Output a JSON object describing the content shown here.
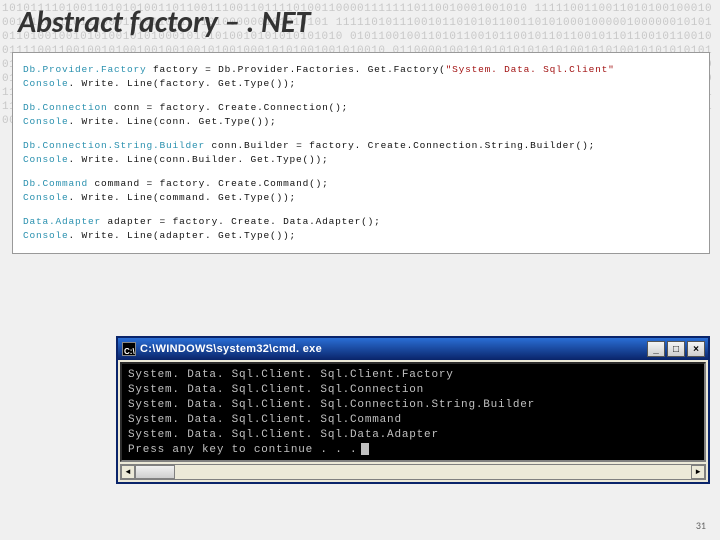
{
  "title": "Abstract factory – . NET",
  "page_number": "31",
  "bg_binary": "10101111010011010101001101100111001101111010011000011111110110010001001010 11111001100110101001000100011110011011000011101101110101000000101010101 11111010111001011010101100110101000100000100000010101 011010010010101001010100010101010010101010101010 010110010011010110010110010110110010110110010110010 011110011001001010010010010010100100010101001001010010 011000010010101010101010100101010010101010101010100101001 11100001001010010010010010010010001001010010010010100 010111010110011001011000111010110010110010111 011111000110011111110100100101001010010010010010010010010010 10010100001001100100100100111001111110001001001100000001000010110011111110 000010110111111011111011110010111011100001110100101111100010100010110011 1011101101011100100000011000010001101010011001101001001111101010010001001101010011101",
  "code": {
    "group1": {
      "line1": {
        "type": "Db.Provider.Factory",
        "var": "factory",
        "assign": "Db.Provider.Factories. Get.Factory(",
        "str": "\"System. Data. Sql.Client\"",
        "end": ""
      },
      "line2": "Console. Write. Line(factory. Get.Type());"
    },
    "group2": {
      "line1": {
        "type": "Db.Connection",
        "var": "conn",
        "assign": "factory. Create.Connection();"
      },
      "line2": "Console. Write. Line(conn. Get.Type());"
    },
    "group3": {
      "line1": {
        "type": "Db.Connection.String.Builder",
        "var": "conn.Builder",
        "assign": "factory. Create.Connection.String.Builder();"
      },
      "line2": "Console. Write. Line(conn.Builder. Get.Type());"
    },
    "group4": {
      "line1": {
        "type": "Db.Command",
        "var": "command",
        "assign": "factory. Create.Command();"
      },
      "line2": "Console. Write. Line(command. Get.Type());"
    },
    "group5": {
      "line1": {
        "type": "Data.Adapter",
        "var": "adapter",
        "assign": "factory. Create. Data.Adapter();"
      },
      "line2": "Console. Write. Line(adapter. Get.Type());"
    }
  },
  "cmd": {
    "title": "C:\\WINDOWS\\system32\\cmd. exe",
    "lines": [
      "System. Data. Sql.Client. Sql.Client.Factory",
      "System. Data. Sql.Client. Sql.Connection",
      "System. Data. Sql.Client. Sql.Connection.String.Builder",
      "System. Data. Sql.Client. Sql.Command",
      "System. Data. Sql.Client. Sql.Data.Adapter",
      "Press any key to continue . . ."
    ],
    "btn_min": "_",
    "btn_max": "□",
    "btn_close": "×"
  }
}
